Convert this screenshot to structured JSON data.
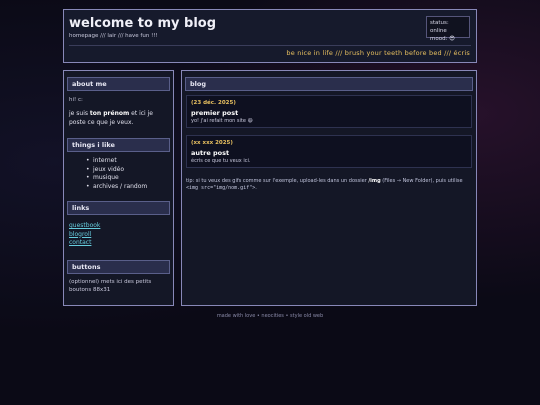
{
  "header": {
    "title": "welcome to my blog",
    "nav": [
      "homepage",
      "lair",
      "have fun !!!"
    ],
    "nav_sep": " /// ",
    "status_label": "status: online",
    "mood_label": "mood: 😎",
    "tagline": "be nice in life /// brush your teeth before bed /// écris"
  },
  "sidebar": {
    "about": {
      "heading": "about me",
      "greeting": "hi! c:",
      "bio_pre": "je suis ",
      "bio_bold": "ton prénom",
      "bio_post": " et ici je poste ce que je veux."
    },
    "likes": {
      "heading": "things i like",
      "items": [
        "internet",
        "jeux vidéo",
        "musique",
        "archives / random"
      ]
    },
    "links": {
      "heading": "links",
      "items": [
        "guestbook",
        "blogroll",
        "contact"
      ]
    },
    "buttons": {
      "heading": "buttons",
      "text": "(optionnel) mets ici des petits boutons 88x31"
    }
  },
  "main": {
    "heading": "blog",
    "posts": [
      {
        "date": "(23 déc. 2025)",
        "title": "premier post",
        "body": "yo! j'ai refait mon site 😄"
      },
      {
        "date": "(xx xxx 2025)",
        "title": "autre post",
        "body": "écris ce que tu veux ici."
      }
    ],
    "tip": {
      "pre": "tip: si tu veux des gifs comme sur l'exemple, upload-les dans un dossier ",
      "folder": "/img",
      "mid": " (Files → New Folder), puis utilise ",
      "code": "<img src=\"img/nom.gif\">",
      "post": "."
    }
  },
  "footer": {
    "items": [
      "made with love",
      "neocities",
      "style old web"
    ],
    "sep": " • "
  }
}
